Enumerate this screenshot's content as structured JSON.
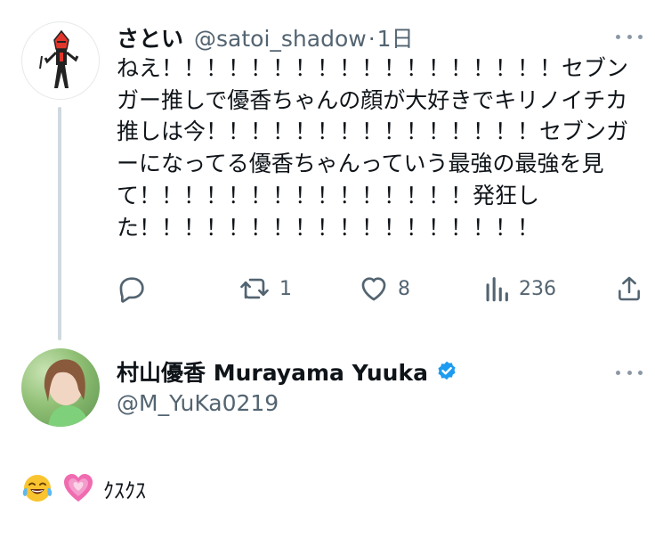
{
  "tweet": {
    "name": "さとい",
    "handle": "@satoi_shadow",
    "separator": "·",
    "time": "1日",
    "text": "ねえ！！！！！！！！！！！！！！！！！！セブンガー推しで優香ちゃんの顔が大好きでキリノイチカ推しは今！！！！！！！！！！！！！！！セブンガーになってる優香ちゃんっていう最強の最強を見て！！！！！！！！！！！！！！！発狂した！！！！！！！！！！！！！！！！！！",
    "actions": {
      "reply": {
        "icon": "reply-icon",
        "count": ""
      },
      "retweet": {
        "icon": "retweet-icon",
        "count": "1"
      },
      "like": {
        "icon": "heart-icon",
        "count": "8"
      },
      "views": {
        "icon": "views-icon",
        "count": "236"
      },
      "share": {
        "icon": "share-icon",
        "count": ""
      }
    }
  },
  "reply": {
    "name": "村山優香 Murayama Yuuka",
    "verified": true,
    "handle": "@M_YuKa0219",
    "emojis": [
      "tears-of-joy-emoji",
      "growing-heart-emoji"
    ],
    "text": "ｸｽｸｽ"
  },
  "colors": {
    "text": "#0f1419",
    "secondary": "#536471",
    "thread_line": "#cfd9de",
    "verified": "#1d9bf0"
  }
}
